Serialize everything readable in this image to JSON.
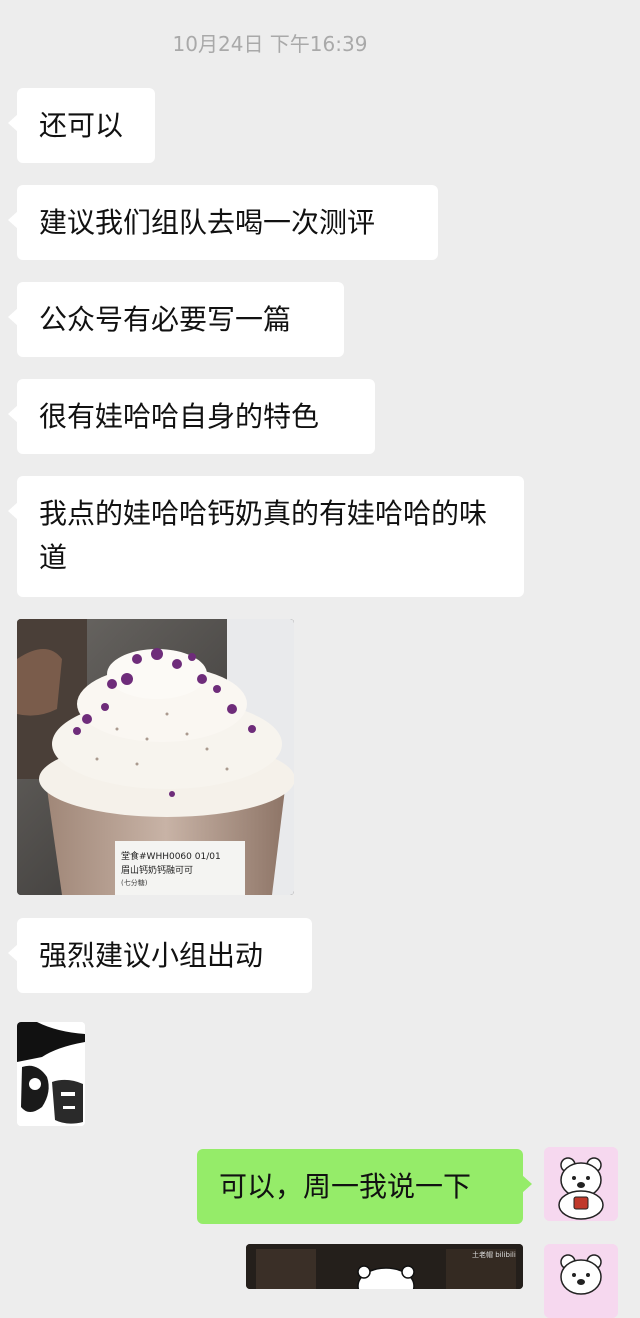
{
  "chat": {
    "timestamp": "10月24日 下午16:39",
    "incoming_messages": [
      "还可以",
      "建议我们组队去喝一次测评",
      "公众号有必要写一篇",
      "很有娃哈哈自身的特色",
      "我点的娃哈哈钙奶真的有娃哈哈的味道"
    ],
    "cup_label": {
      "line1": "堂食#WHH0060 01/01",
      "line2": "眉山钙奶钙融可可",
      "line3": "(七分糖)"
    },
    "after_photo_message": "强烈建议小组出动",
    "outgoing_message": "可以，周一我说一下",
    "video_watermark": "土老帽 bilibili"
  },
  "colors": {
    "background": "#ededed",
    "incoming_bubble": "#ffffff",
    "outgoing_bubble": "#95ec69",
    "timestamp_text": "#a9a9a9"
  }
}
